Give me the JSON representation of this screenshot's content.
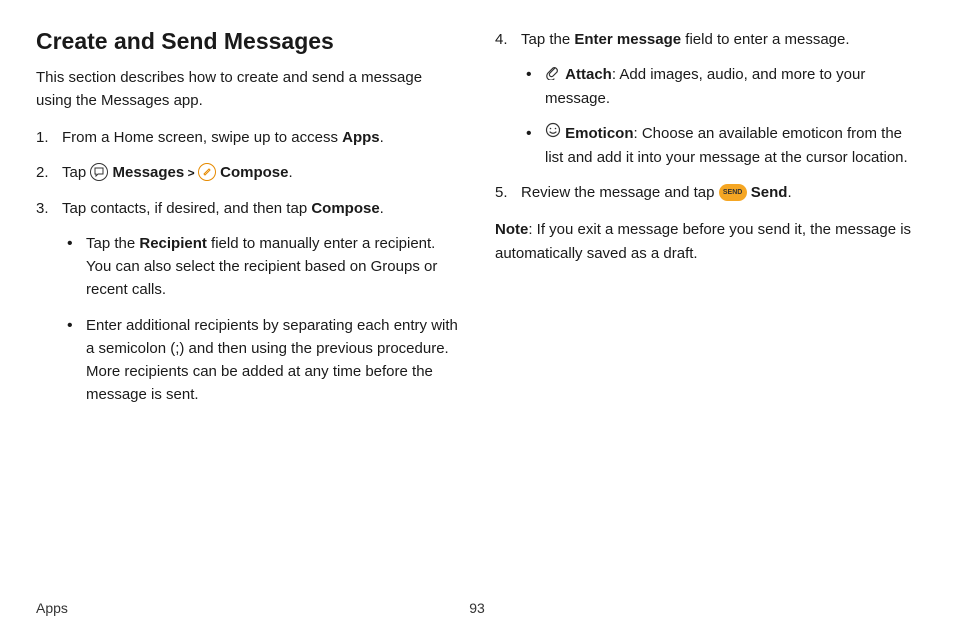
{
  "heading": "Create and Send Messages",
  "intro": "This section describes how to create and send a message using the Messages app.",
  "steps": {
    "s1": {
      "num": "1.",
      "prefix": "From a Home screen, swipe up to access ",
      "bold": "Apps",
      "suffix": "."
    },
    "s2": {
      "num": "2.",
      "prefix": "Tap ",
      "app": "Messages",
      "chev": " > ",
      "action": "Compose",
      "suffix": "."
    },
    "s3": {
      "num": "3.",
      "prefix": "Tap contacts, if desired, and then tap ",
      "bold": "Compose",
      "suffix": ".",
      "bullets": {
        "b1": {
          "prefix": "Tap the ",
          "bold": "Recipient",
          "suffix": " field to manually enter a recipient. You can also select the recipient based on Groups or recent calls."
        },
        "b2": {
          "text": "Enter additional recipients by separating each entry with a semicolon (;) and then using the previous procedure. More recipients can be added at any time before the message is sent."
        }
      }
    },
    "s4": {
      "num": "4.",
      "prefix": "Tap the ",
      "bold": "Enter message",
      "suffix": " field to enter a message.",
      "bullets": {
        "b1": {
          "bold": "Attach",
          "suffix": ": Add images, audio, and more to your message."
        },
        "b2": {
          "bold": "Emoticon",
          "suffix": ": Choose an available emoticon from the list and add it into your message at the cursor location."
        }
      }
    },
    "s5": {
      "num": "5.",
      "prefix": "Review the message and tap ",
      "bold": "Send",
      "suffix": "."
    }
  },
  "note": {
    "label": "Note",
    "text": ": If you exit a message before you send it, the message is automatically saved as a draft."
  },
  "footer": {
    "section": "Apps",
    "page": "93"
  },
  "send_badge": "SEND"
}
